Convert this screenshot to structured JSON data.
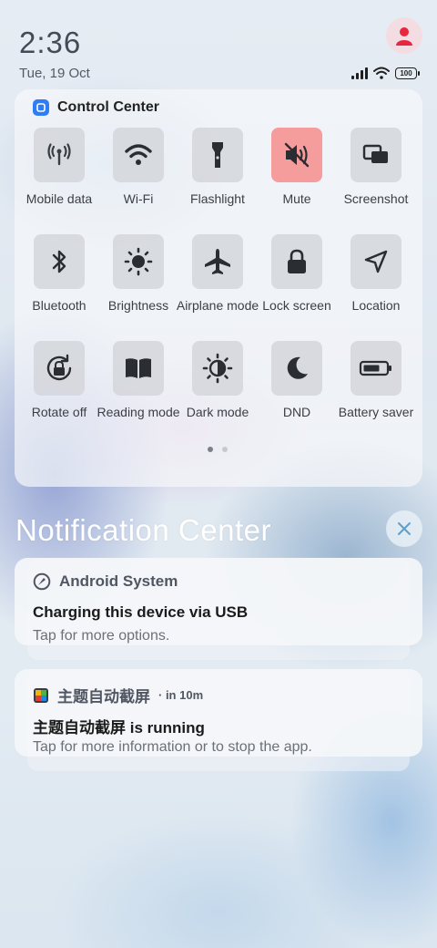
{
  "status_bar": {
    "time": "2:36",
    "date": "Tue, 19 Oct",
    "battery": "100",
    "icons": [
      "signal-icon",
      "wifi-icon",
      "battery-icon"
    ]
  },
  "control_center": {
    "title": "Control Center",
    "tiles": [
      {
        "label": "Mobile data",
        "icon": "mobile-data-icon",
        "active": false
      },
      {
        "label": "Wi-Fi",
        "icon": "wifi-icon",
        "active": false
      },
      {
        "label": "Flashlight",
        "icon": "flashlight-icon",
        "active": false
      },
      {
        "label": "Mute",
        "icon": "mute-icon",
        "active": true
      },
      {
        "label": "Screenshot",
        "icon": "screenshot-icon",
        "active": false
      },
      {
        "label": "Bluetooth",
        "icon": "bluetooth-icon",
        "active": false
      },
      {
        "label": "Brightness",
        "icon": "brightness-icon",
        "active": false
      },
      {
        "label": "Airplane mode",
        "icon": "airplane-icon",
        "active": false
      },
      {
        "label": "Lock screen",
        "icon": "lock-icon",
        "active": false
      },
      {
        "label": "Location",
        "icon": "location-icon",
        "active": false
      },
      {
        "label": "Rotate off",
        "icon": "rotate-lock-icon",
        "active": false
      },
      {
        "label": "Reading mode",
        "icon": "book-icon",
        "active": false
      },
      {
        "label": "Dark mode",
        "icon": "dark-mode-icon",
        "active": false
      },
      {
        "label": "DND",
        "icon": "moon-icon",
        "active": false
      },
      {
        "label": "Battery saver",
        "icon": "battery-saver-icon",
        "active": false
      }
    ],
    "page_count": 2,
    "current_page": 1
  },
  "notification_center": {
    "title": "Notification Center",
    "notifications": [
      {
        "app": "Android System",
        "time": "",
        "title": "Charging this device via USB",
        "body": "Tap for more options.",
        "icon": "android-system-icon"
      },
      {
        "app": "主题自动截屏",
        "time": "· in 10m",
        "title": "主题自动截屏 is running",
        "body": "Tap for more information or to stop the app.",
        "icon": "app-icon"
      }
    ]
  },
  "colors": {
    "mute_active": "#f59c9c",
    "tile_bg": "#d4d6da",
    "accent_logo": "#2e7cf6"
  }
}
